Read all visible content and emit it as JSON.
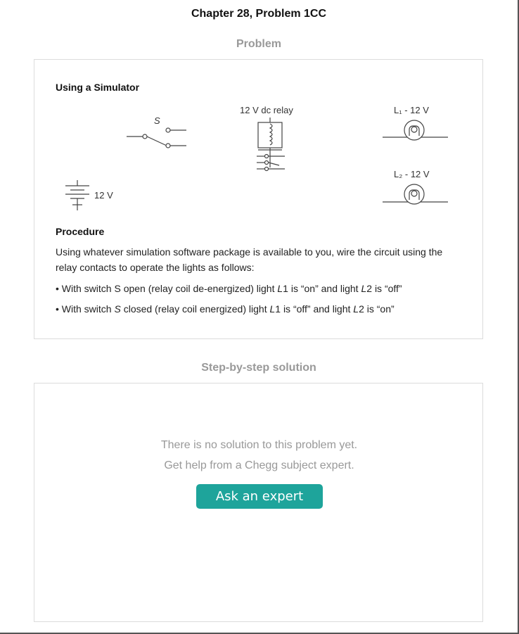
{
  "page": {
    "title": "Chapter 28, Problem 1CC"
  },
  "problem": {
    "heading": "Problem",
    "subheading": "Using a Simulator",
    "circuit": {
      "switch_label": "S",
      "relay_label": "12 V dc relay",
      "lamp1_label": "L₁ - 12 V",
      "lamp2_label": "L₂ - 12 V",
      "battery_label": "12 V"
    },
    "procedure_heading": "Procedure",
    "intro": "Using whatever simulation software package is available to you, wire the circuit using the relay contacts to operate the lights as follows:",
    "bullet1": {
      "prefix": "• With switch S open (relay coil de-energized) light ",
      "v1": "L",
      "mid": "1 is “on” and light ",
      "v2": "L",
      "suffix": "2 is “off”"
    },
    "bullet2": {
      "prefix": "• With switch ",
      "v0": "S",
      "mid0": " closed (relay coil energized) light ",
      "v1": "L",
      "mid": "1 is “off” and light ",
      "v2": "L",
      "suffix": "2 is “on”"
    }
  },
  "solution": {
    "heading": "Step-by-step solution",
    "empty_line1": "There is no solution to this problem yet.",
    "empty_line2": "Get help from a Chegg subject expert.",
    "ask_button": "Ask an expert"
  },
  "colors": {
    "accent": "#1ea49b",
    "muted_text": "#999999",
    "card_border": "#dcdcdc"
  }
}
